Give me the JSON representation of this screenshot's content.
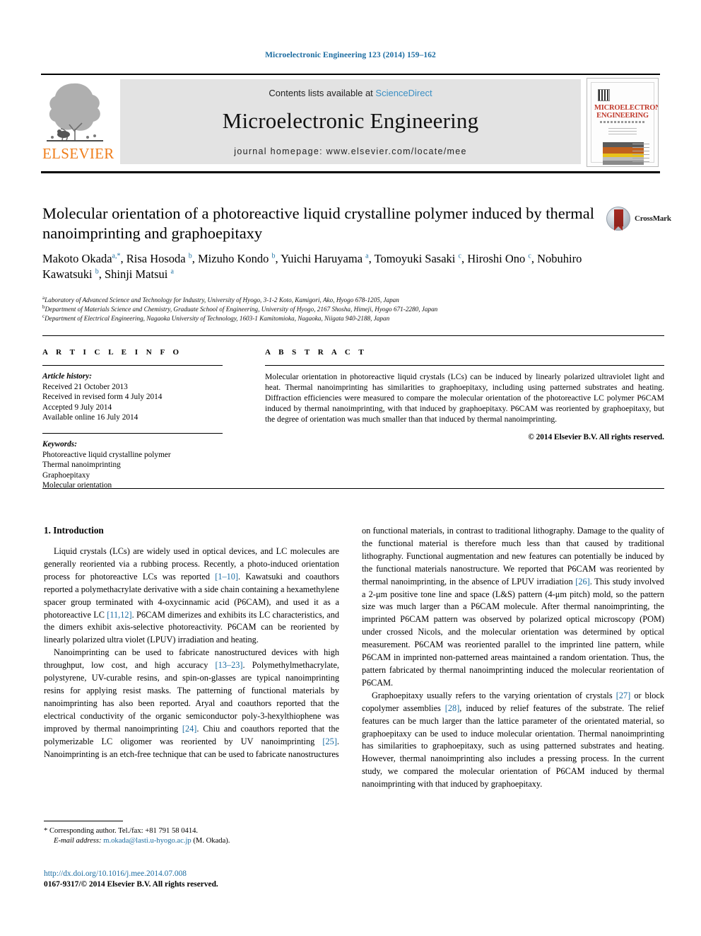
{
  "running_head": "Microelectronic Engineering 123 (2014) 159–162",
  "masthead": {
    "contents_prefix": "Contents lists available at ",
    "sciencedirect": "ScienceDirect",
    "journal_title": "Microelectronic Engineering",
    "homepage": "journal homepage: www.elsevier.com/locate/mee",
    "publisher_logo_text": "ELSEVIER",
    "cover_title_line1": "MICROELECTRONIC",
    "cover_title_line2": "ENGINEERING"
  },
  "crossmark": {
    "label": "CrossMark"
  },
  "article": {
    "title": "Molecular orientation of a photoreactive liquid crystalline polymer induced by thermal nanoimprinting and graphoepitaxy",
    "authors_html": "Makoto Okada<sup>a,*</sup>, Risa Hosoda <sup>b</sup>, Mizuho Kondo <sup>b</sup>, Yuichi Haruyama <sup>a</sup>, Tomoyuki Sasaki <sup>c</sup>, Hiroshi Ono <sup>c</sup>, Nobuhiro Kawatsuki <sup>b</sup>, Shinji Matsui <sup>a</sup>",
    "affiliations": [
      {
        "marker": "a",
        "text": "Laboratory of Advanced Science and Technology for Industry, University of Hyogo, 3-1-2 Koto, Kamigori, Ako, Hyogo 678-1205, Japan"
      },
      {
        "marker": "b",
        "text": "Department of Materials Science and Chemistry, Graduate School of Engineering, University of Hyogo, 2167 Shosha, Himeji, Hyogo 671-2280, Japan"
      },
      {
        "marker": "c",
        "text": "Department of Electrical Engineering, Nagaoka University of Technology, 1603-1 Kamitomioka, Nagaoka, Niigata 940-2188, Japan"
      }
    ]
  },
  "article_info": {
    "heading": "A R T I C L E    I N F O",
    "history_label": "Article history:",
    "history": [
      "Received 21 October 2013",
      "Received in revised form 4 July 2014",
      "Accepted 9 July 2014",
      "Available online 16 July 2014"
    ],
    "keywords_label": "Keywords:",
    "keywords": [
      "Photoreactive liquid crystalline polymer",
      "Thermal nanoimprinting",
      "Graphoepitaxy",
      "Molecular orientation"
    ]
  },
  "abstract": {
    "heading": "A B S T R A C T",
    "text": "Molecular orientation in photoreactive liquid crystals (LCs) can be induced by linearly polarized ultraviolet light and heat. Thermal nanoimprinting has similarities to graphoepitaxy, including using patterned substrates and heating. Diffraction efficiencies were measured to compare the molecular orientation of the photoreactive LC polymer P6CAM induced by thermal nanoimprinting, with that induced by graphoepitaxy. P6CAM was reoriented by graphoepitaxy, but the degree of orientation was much smaller than that induced by thermal nanoimprinting.",
    "copyright": "© 2014 Elsevier B.V. All rights reserved."
  },
  "body": {
    "section_heading": "1. Introduction",
    "left_paragraphs": [
      {
        "segments": [
          {
            "t": "Liquid crystals (LCs) are widely used in optical devices, and LC molecules are generally reoriented via a rubbing process. Recently, a photo-induced orientation process for photoreactive LCs was reported "
          },
          {
            "t": "[1–10]",
            "ref": true
          },
          {
            "t": ". Kawatsuki and coauthors reported a polymethacrylate derivative with a side chain containing a hexamethylene spacer group terminated with 4-oxycinnamic acid (P6CAM), and used it as a photoreactive LC "
          },
          {
            "t": "[11,12]",
            "ref": true
          },
          {
            "t": ". P6CAM dimerizes and exhibits its LC characteristics, and the dimers exhibit axis-selective photoreactivity. P6CAM can be reoriented by linearly polarized ultra violet (LPUV) irradiation and heating."
          }
        ]
      },
      {
        "segments": [
          {
            "t": "Nanoimprinting can be used to fabricate nanostructured devices with high throughput, low cost, and high accuracy "
          },
          {
            "t": "[13–23]",
            "ref": true
          },
          {
            "t": ". Polymethylmethacrylate, polystyrene, UV-curable resins, and spin-on-glasses are typical nanoimprinting resins for applying resist masks. The patterning of functional materials by nanoimprinting has also been reported. Aryal and coauthors reported that the electrical conductivity of the organic semiconductor poly-3-hexylthiophene was improved by thermal nanoimprinting "
          },
          {
            "t": "[24]",
            "ref": true
          },
          {
            "t": ". Chiu and coauthors reported that the polymerizable LC oligomer was reoriented by UV nanoimprinting "
          },
          {
            "t": "[25]",
            "ref": true
          },
          {
            "t": ". Nanoimprinting is an etch-free technique that can be used to fabricate nanostructures"
          }
        ]
      }
    ],
    "right_paragraphs": [
      {
        "continuation": true,
        "segments": [
          {
            "t": "on functional materials, in contrast to traditional lithography. Damage to the quality of the functional material is therefore much less than that caused by traditional lithography. Functional augmentation and new features can potentially be induced by the functional materials nanostructure. We reported that P6CAM was reoriented by thermal nanoimprinting, in the absence of LPUV irradiation "
          },
          {
            "t": "[26]",
            "ref": true
          },
          {
            "t": ". This study involved a 2-μm positive tone line and space (L&S) pattern (4-μm pitch) mold, so the pattern size was much larger than a P6CAM molecule. After thermal nanoimprinting, the imprinted P6CAM pattern was observed by polarized optical microscopy (POM) under crossed Nicols, and the molecular orientation was determined by optical measurement. P6CAM was reoriented parallel to the imprinted line pattern, while P6CAM in imprinted non-patterned areas maintained a random orientation. Thus, the pattern fabricated by thermal nanoimprinting induced the molecular reorientation of P6CAM."
          }
        ]
      },
      {
        "segments": [
          {
            "t": "Graphoepitaxy usually refers to the varying orientation of crystals "
          },
          {
            "t": "[27]",
            "ref": true
          },
          {
            "t": " or block copolymer assemblies "
          },
          {
            "t": "[28]",
            "ref": true
          },
          {
            "t": ", induced by relief features of the substrate. The relief features can be much larger than the lattice parameter of the orientated material, so graphoepitaxy can be used to induce molecular orientation. Thermal nanoimprinting has similarities to graphoepitaxy, such as using patterned substrates and heating. However, thermal nanoimprinting also includes a pressing process. In the current study, we compared the molecular orientation of P6CAM induced by thermal nanoimprinting with that induced by graphoepitaxy."
          }
        ]
      }
    ]
  },
  "footnote": {
    "marker": "*",
    "corresponding": "Corresponding author. Tel./fax: +81 791 58 0414.",
    "email_label": "E-mail address:",
    "email": "m.okada@lasti.u-hyogo.ac.jp",
    "email_suffix": "(M. Okada)."
  },
  "footer": {
    "doi": "http://dx.doi.org/10.1016/j.mee.2014.07.008",
    "issn_line": "0167-9317/© 2014 Elsevier B.V. All rights reserved."
  },
  "colors": {
    "link_blue": "#1a6ba0",
    "sciencedirect_blue": "#3a8fc4",
    "elsevier_orange": "#ef7d1a",
    "crossmark_red": "#a32a22",
    "band_gray": "#e3e3e3"
  }
}
